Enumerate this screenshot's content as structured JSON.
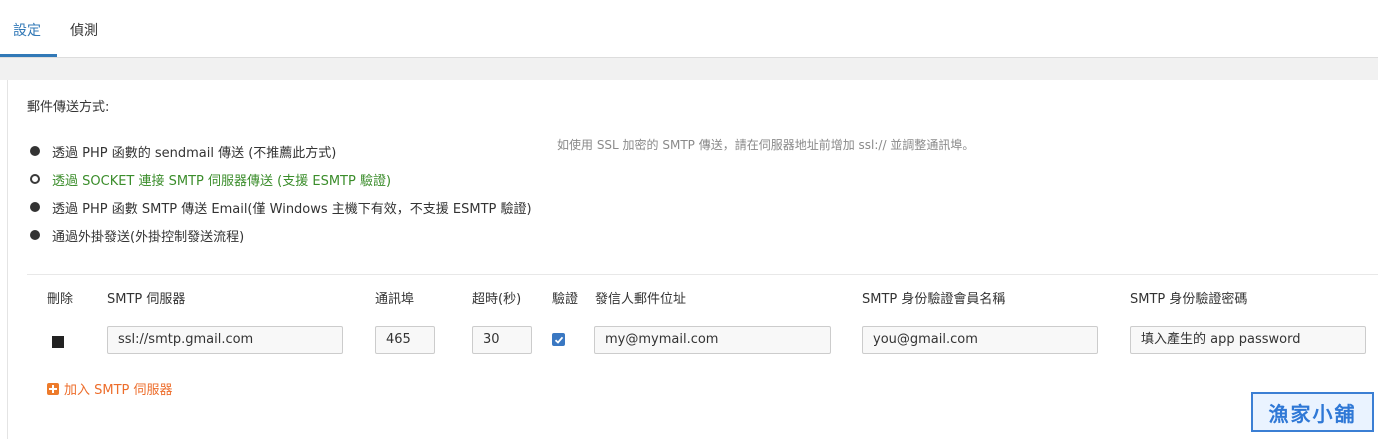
{
  "tabs": [
    {
      "label": "設定",
      "active": true
    },
    {
      "label": "偵測",
      "active": false
    }
  ],
  "mail_method": {
    "label": "郵件傳送方式:",
    "options": [
      {
        "label": "透過 PHP 函數的 sendmail 傳送 (不推薦此方式)",
        "selected": false
      },
      {
        "label": "透過 SOCKET 連接 SMTP 伺服器傳送 (支援 ESMTP 驗證)",
        "selected": true
      },
      {
        "label": "透過 PHP 函數 SMTP 傳送 Email(僅 Windows 主機下有效，不支援 ESMTP 驗證)",
        "selected": false
      },
      {
        "label": "通過外掛發送(外掛控制發送流程)",
        "selected": false
      }
    ],
    "hint": "如使用 SSL 加密的 SMTP 傳送，請在伺服器地址前增加 ssl:// 並調整通訊埠。"
  },
  "smtp_table": {
    "headers": {
      "delete": "刪除",
      "server": "SMTP 伺服器",
      "port": "通訊埠",
      "timeout": "超時(秒)",
      "auth": "驗證",
      "from": "發信人郵件位址",
      "username": "SMTP 身份驗證會員名稱",
      "password": "SMTP 身份驗證密碼"
    },
    "rows": [
      {
        "server": "ssl://smtp.gmail.com",
        "port": "465",
        "timeout": "30",
        "auth_checked": true,
        "from": "my@mymail.com",
        "username": "you@gmail.com",
        "password": "填入產生的 app password"
      }
    ],
    "add_label": "加入 SMTP 伺服器"
  },
  "watermark": "漁家小舖",
  "colors": {
    "accent_blue": "#3279b7",
    "selected_green": "#3b8d2b",
    "add_orange": "#ed6d2b"
  }
}
